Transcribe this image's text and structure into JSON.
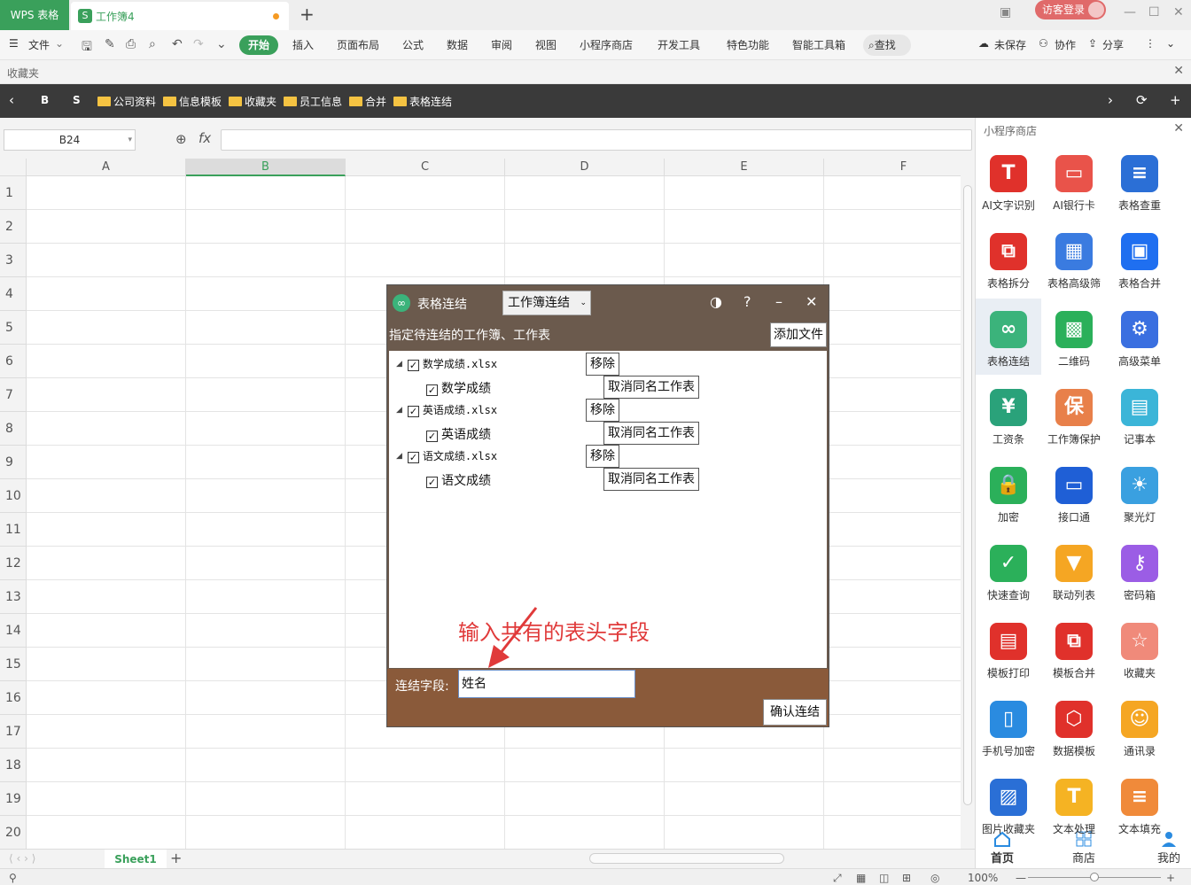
{
  "titlebar": {
    "app_tab": "WPS 表格",
    "doc_tab": "工作簿4",
    "new_tab": "+",
    "login": "访客登录"
  },
  "ribbon": {
    "file": "文件",
    "tabs": [
      "开始",
      "插入",
      "页面布局",
      "公式",
      "数据",
      "审阅",
      "视图",
      "小程序商店",
      "开发工具",
      "特色功能",
      "智能工具箱"
    ],
    "search": "查找",
    "unsaved": "未保存",
    "collab": "协作",
    "share": "分享"
  },
  "favorites": {
    "label": "收藏夹"
  },
  "bookmarks": {
    "b": "B",
    "s": "S",
    "folders": [
      "公司资料",
      "信息模板",
      "收藏夹",
      "员工信息",
      "合并",
      "表格连结"
    ]
  },
  "formula": {
    "cell_ref": "B24",
    "fx": "fx"
  },
  "sheet": {
    "columns": [
      "A",
      "B",
      "C",
      "D",
      "E",
      "F"
    ],
    "rows": [
      "1",
      "2",
      "3",
      "4",
      "5",
      "6",
      "7",
      "8",
      "9",
      "10",
      "11",
      "12",
      "13",
      "14",
      "15",
      "16",
      "17",
      "18",
      "19",
      "20"
    ],
    "selected_column": "B",
    "tab": "Sheet1"
  },
  "status": {
    "zoom": "100%"
  },
  "panel": {
    "title": "小程序商店",
    "apps": [
      {
        "name": "AI文字识别",
        "color": "#e0312b",
        "glyph": "T"
      },
      {
        "name": "AI银行卡",
        "color": "#e9534a",
        "glyph": "▭"
      },
      {
        "name": "表格查重",
        "color": "#2b6fd6",
        "glyph": "≡"
      },
      {
        "name": "表格拆分",
        "color": "#e0312b",
        "glyph": "⧉"
      },
      {
        "name": "表格高级筛",
        "color": "#3a7be0",
        "glyph": "▦"
      },
      {
        "name": "表格合并",
        "color": "#1f6ff0",
        "glyph": "▣"
      },
      {
        "name": "表格连结",
        "color": "#3bb37b",
        "glyph": "∞"
      },
      {
        "name": "二维码",
        "color": "#2bb05a",
        "glyph": "▩"
      },
      {
        "name": "高级菜单",
        "color": "#3a6fe0",
        "glyph": "⚙"
      },
      {
        "name": "工资条",
        "color": "#2aa27a",
        "glyph": "¥"
      },
      {
        "name": "工作簿保护",
        "color": "#e8804a",
        "glyph": "保"
      },
      {
        "name": "记事本",
        "color": "#3bb5d8",
        "glyph": "▤"
      },
      {
        "name": "加密",
        "color": "#2bb05a",
        "glyph": "🔒"
      },
      {
        "name": "接口通",
        "color": "#1f5fd6",
        "glyph": "▭"
      },
      {
        "name": "聚光灯",
        "color": "#3aa0e0",
        "glyph": "☀"
      },
      {
        "name": "快速查询",
        "color": "#2bb05a",
        "glyph": "✓"
      },
      {
        "name": "联动列表",
        "color": "#f5a623",
        "glyph": "▼"
      },
      {
        "name": "密码箱",
        "color": "#9b5de5",
        "glyph": "⚷"
      },
      {
        "name": "模板打印",
        "color": "#e0312b",
        "glyph": "▤"
      },
      {
        "name": "模板合并",
        "color": "#e0312b",
        "glyph": "⧉"
      },
      {
        "name": "收藏夹",
        "color": "#f08a7a",
        "glyph": "☆"
      },
      {
        "name": "手机号加密",
        "color": "#2a8be0",
        "glyph": "▯"
      },
      {
        "name": "数据模板",
        "color": "#e0312b",
        "glyph": "⬡"
      },
      {
        "name": "通讯录",
        "color": "#f5a623",
        "glyph": "☺"
      },
      {
        "name": "图片收藏夹",
        "color": "#2a6fd6",
        "glyph": "▨"
      },
      {
        "name": "文本处理",
        "color": "#f5b323",
        "glyph": "T"
      },
      {
        "name": "文本填充",
        "color": "#f08a3a",
        "glyph": "≡"
      }
    ],
    "nav": [
      "首页",
      "商店",
      "我的"
    ]
  },
  "dialog": {
    "title": "表格连结",
    "mode": "工作簿连结",
    "hint": "指定待连结的工作簿、工作表",
    "add_file": "添加文件",
    "files": [
      {
        "file": "数学成绩.xlsx",
        "sheet": "数学成绩"
      },
      {
        "file": "英语成绩.xlsx",
        "sheet": "英语成绩"
      },
      {
        "file": "语文成绩.xlsx",
        "sheet": "语文成绩"
      }
    ],
    "remove_label": "移除",
    "cancel_same_label": "取消同名工作表",
    "annotation": "输入共有的表头字段",
    "field_label": "连结字段:",
    "field_value": "姓名",
    "confirm": "确认连结"
  }
}
